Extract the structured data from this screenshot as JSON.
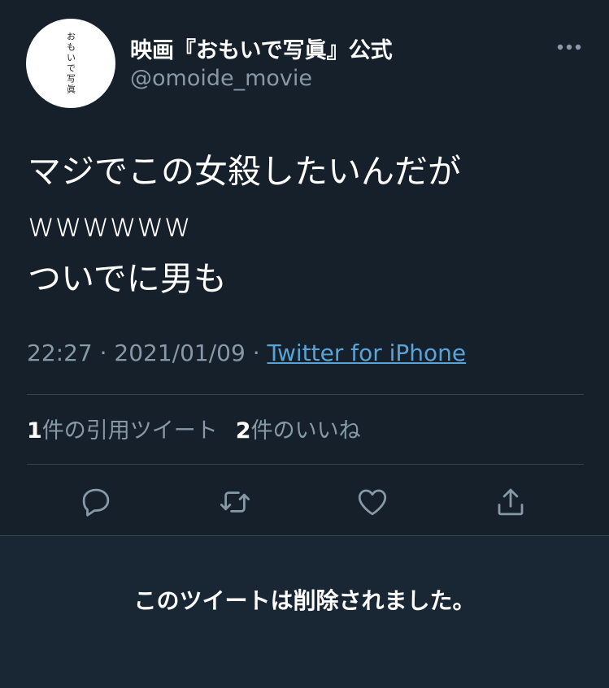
{
  "tweet": {
    "avatar_text": "おもいで写眞",
    "display_name": "映画『おもいで写眞』公式",
    "handle": "@omoide_movie",
    "body": "マジでこの女殺したいんだが\nwwwwww\nついでに男も",
    "time": "22:27",
    "date": "2021/01/09",
    "separator": " · ",
    "source": "Twitter for iPhone",
    "quote_count": "1",
    "quote_label": "件の引用ツイート",
    "like_count": "2",
    "like_label": "件のいいね"
  },
  "deleted_notice": "このツイートは削除されました。",
  "icons": {
    "more": "more-horizontal-icon",
    "reply": "reply-icon",
    "retweet": "retweet-icon",
    "like": "heart-icon",
    "share": "share-icon"
  },
  "colors": {
    "background": "#15202b",
    "deleted_background": "#192734",
    "secondary_text": "#8899a6",
    "link": "#5aa3d6",
    "divider": "#38444d"
  }
}
